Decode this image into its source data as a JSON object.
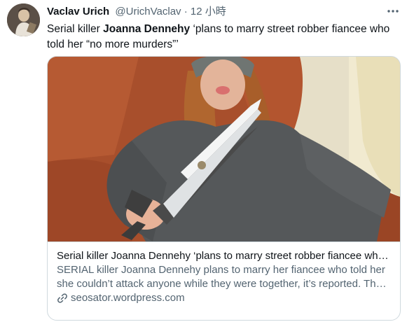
{
  "tweet": {
    "author_name": "Vaclav Urich",
    "author_handle": "@UrichVaclav",
    "separator": "·",
    "time": "12 小時",
    "text_before": "Serial killer ",
    "text_bold": "Joanna Dennehy",
    "text_after": " ‘plans to marry street robber fiancee who told her “no more murders”’",
    "more_icon": "more-dots-icon"
  },
  "card": {
    "title": "Serial killer Joanna Dennehy ‘plans to marry street robber fiancee who …",
    "description": "SERIAL killer Joanna Dennehy plans to marry her fiancee who told her she couldn’t attack anyone while they were together, it’s reported. The …",
    "domain": "seosator.wordpress.com",
    "link_icon": "link-icon"
  },
  "colors": {
    "text": "#0f1419",
    "secondary": "#536471",
    "border": "#cfd9de",
    "sweater": "#55585a",
    "couch": "#a9512d"
  }
}
